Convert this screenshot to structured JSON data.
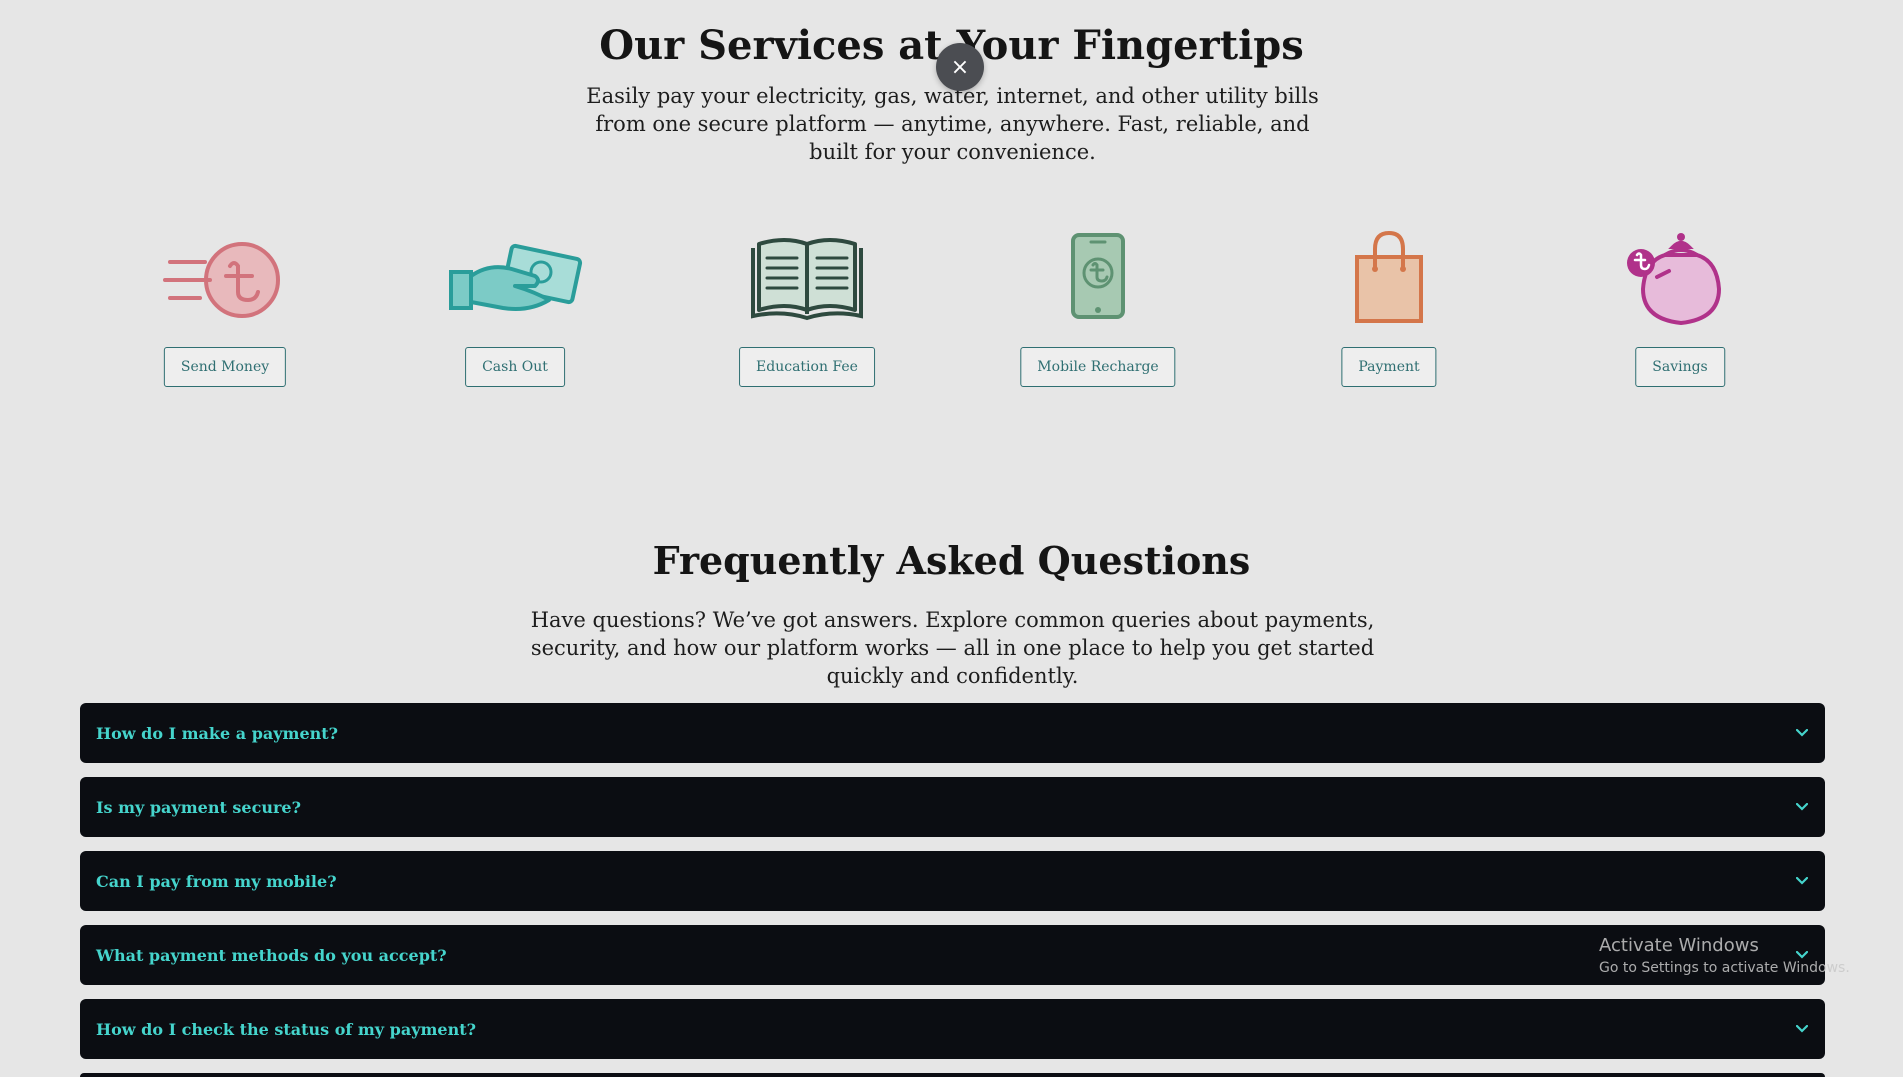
{
  "services": {
    "title": "Our Services at Your Fingertips",
    "subtitle": "Easily pay your electricity, gas, water, internet, and other utility bills from one secure platform — anytime, anywhere. Fast, reliable, and built for your convenience.",
    "close_glyph": "×",
    "items": [
      {
        "label": "Send Money",
        "icon": "send-money-icon",
        "color": "#d2737c"
      },
      {
        "label": "Cash Out",
        "icon": "cash-out-icon",
        "color": "#2a9d9a"
      },
      {
        "label": "Education Fee",
        "icon": "book-icon",
        "color": "#2e4a3f"
      },
      {
        "label": "Mobile Recharge",
        "icon": "mobile-recharge-icon",
        "color": "#5e9272"
      },
      {
        "label": "Payment",
        "icon": "shopping-bag-icon",
        "color": "#d4764a"
      },
      {
        "label": "Savings",
        "icon": "savings-jar-icon",
        "color": "#b0328a"
      }
    ]
  },
  "faq": {
    "title": "Frequently Asked Questions",
    "subtitle": "Have questions? We’ve got answers. Explore common queries about payments, security, and how our platform works — all in one place to help you get started quickly and confidently.",
    "items": [
      {
        "question": "How do I make a payment?"
      },
      {
        "question": "Is my payment secure?"
      },
      {
        "question": "Can I pay from my mobile?"
      },
      {
        "question": "What payment methods do you accept?"
      },
      {
        "question": "How do I check the status of my payment?"
      }
    ]
  },
  "watermark": {
    "line1": "Activate Windows",
    "line2": "Go to Settings to activate Windows."
  },
  "colors": {
    "faq_background": "#0b0d12",
    "faq_text": "#45d4cc",
    "button_border": "#2f6f72",
    "page_background": "#e6e6e6"
  }
}
